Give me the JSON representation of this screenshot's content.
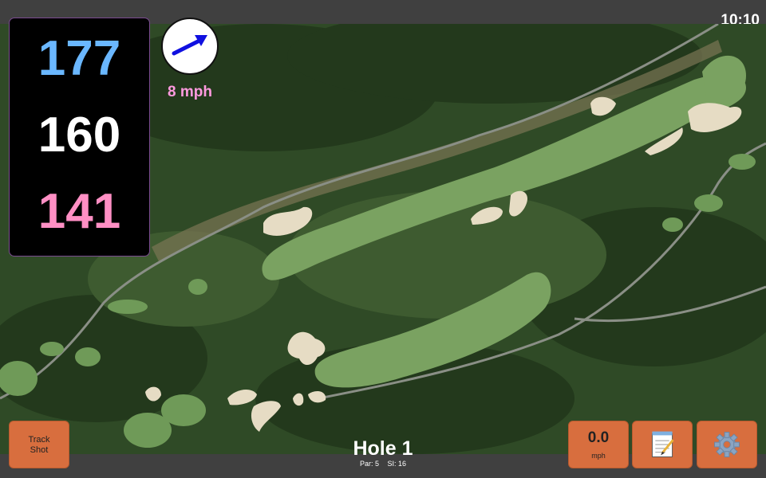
{
  "status": {
    "time": "10:10"
  },
  "distances": {
    "back": "177",
    "middle": "160",
    "front": "141"
  },
  "wind": {
    "speed": "8 mph",
    "arrow_icon": "wind-arrow-icon"
  },
  "hole": {
    "title": "Hole 1",
    "par": "Par: 5",
    "stroke_index": "SI: 16"
  },
  "controls": {
    "track_shot": {
      "line1": "Track",
      "line2": "Shot"
    },
    "speed": {
      "value": "0.0",
      "unit": "mph"
    },
    "notes_icon": "notepad-icon",
    "settings_icon": "gear-icon"
  },
  "colors": {
    "back_distance": "#6ab7ff",
    "middle_distance": "#ffffff",
    "front_distance": "#ff8fc4",
    "wind_text": "#ff9adf",
    "button": "#d86e3e"
  }
}
